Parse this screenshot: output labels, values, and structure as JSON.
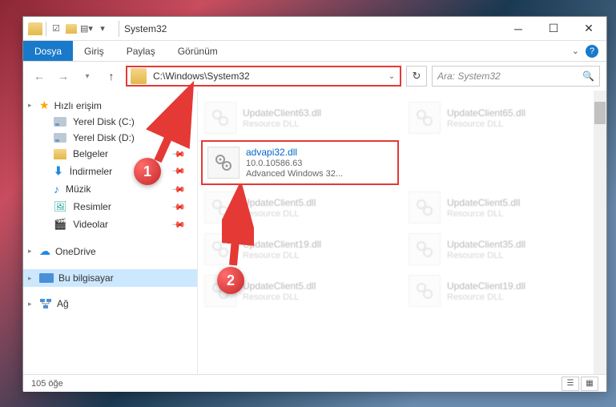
{
  "title": "System32",
  "ribbon": {
    "file": "Dosya",
    "home": "Giriş",
    "share": "Paylaş",
    "view": "Görünüm"
  },
  "address": "C:\\Windows\\System32",
  "search_placeholder": "Ara: System32",
  "sidebar": {
    "quick_access": "Hızlı erişim",
    "items": [
      {
        "label": "Yerel Disk (C:)",
        "icon": "drive"
      },
      {
        "label": "Yerel Disk (D:)",
        "icon": "drive"
      },
      {
        "label": "Belgeler",
        "icon": "folder"
      },
      {
        "label": "İndirmeler",
        "icon": "download"
      },
      {
        "label": "Müzik",
        "icon": "music"
      },
      {
        "label": "Resimler",
        "icon": "picture"
      },
      {
        "label": "Videolar",
        "icon": "video"
      }
    ],
    "onedrive": "OneDrive",
    "thispc": "Bu bilgisayar",
    "network": "Ağ"
  },
  "files": {
    "highlighted": {
      "name": "advapi32.dll",
      "version": "10.0.10586.63",
      "desc": "Advanced Windows 32..."
    },
    "faded": [
      {
        "name": "UpdateClient63.dll",
        "desc": "Resource DLL"
      },
      {
        "name": "UpdateClient65.dll",
        "desc": "Resource DLL"
      },
      {
        "name": "UpdateClient5.dll",
        "desc": "Resource DLL"
      },
      {
        "name": "UpdateClient5.dll",
        "desc": "Resource DLL"
      },
      {
        "name": "UpdateClient19.dll",
        "desc": "Resource DLL"
      },
      {
        "name": "UpdateClient35.dll",
        "desc": "Resource DLL"
      },
      {
        "name": "UpdateClient5.dll",
        "desc": "Resource DLL"
      },
      {
        "name": "UpdateClient19.dll",
        "desc": "Resource DLL"
      }
    ]
  },
  "status": "105 öğe",
  "callouts": {
    "c1": "1",
    "c2": "2"
  }
}
